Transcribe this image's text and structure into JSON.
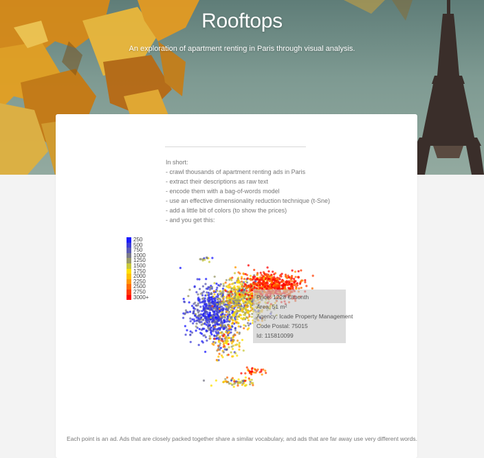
{
  "header": {
    "title": "Rooftops",
    "subtitle": "An exploration of apartment renting in Paris through visual analysis."
  },
  "summary": {
    "lines": [
      "In short:",
      "- crawl thousands of apartment renting ads in Paris",
      "- extract their descriptions as raw text",
      "- encode them with a bag-of-words model",
      "- use an effective dimensionality reduction technique (t-Sne)",
      "- add a little bit of colors (to show the prices)",
      "- and you get this:"
    ]
  },
  "legend": {
    "items": [
      {
        "label": "250",
        "color": "#1a1aff"
      },
      {
        "label": "500",
        "color": "#3d3dd6"
      },
      {
        "label": "750",
        "color": "#5a5ab4"
      },
      {
        "label": "1000",
        "color": "#7a7a8a"
      },
      {
        "label": "1250",
        "color": "#9a9a6a"
      },
      {
        "label": "1500",
        "color": "#c8c83a"
      },
      {
        "label": "1750",
        "color": "#ffe000"
      },
      {
        "label": "2000",
        "color": "#ffc000"
      },
      {
        "label": "2250",
        "color": "#ff9800"
      },
      {
        "label": "2500",
        "color": "#ff6a00"
      },
      {
        "label": "2750",
        "color": "#ff3a00"
      },
      {
        "label": "3000+",
        "color": "#ff0000"
      }
    ]
  },
  "tooltip": {
    "price": "Price: 1228 €/month",
    "area": "Area: 51 m²",
    "agency": "Agency: Icade Property Management",
    "postal": "Code Postal: 75015",
    "id": "Id: 115810099"
  },
  "chart_data": {
    "type": "scatter",
    "title": "",
    "xlabel": "",
    "ylabel": "",
    "legend_title": "",
    "legend_position": "left",
    "color_bins": [
      250,
      500,
      750,
      1000,
      1250,
      1500,
      1750,
      2000,
      2250,
      2500,
      2750,
      3000
    ],
    "clusters": [
      {
        "region": "left blob",
        "dominant_price": 500,
        "approx_points": 650
      },
      {
        "region": "center blob",
        "dominant_price": 1500,
        "approx_points": 600
      },
      {
        "region": "upper-right blob",
        "dominant_price": 3000,
        "approx_points": 550
      },
      {
        "region": "lower tail",
        "dominant_price": 1750,
        "approx_points": 120
      },
      {
        "region": "bottom strip",
        "dominant_price": 1500,
        "approx_points": 60
      }
    ],
    "hovered_point": {
      "price": 1228,
      "area": 51,
      "postal": "75015",
      "id": "115810099"
    }
  },
  "footer": {
    "caption": "Each point is an ad. Ads that are closely packed together share a similar vocabulary, and ads that are far away use very different words."
  }
}
